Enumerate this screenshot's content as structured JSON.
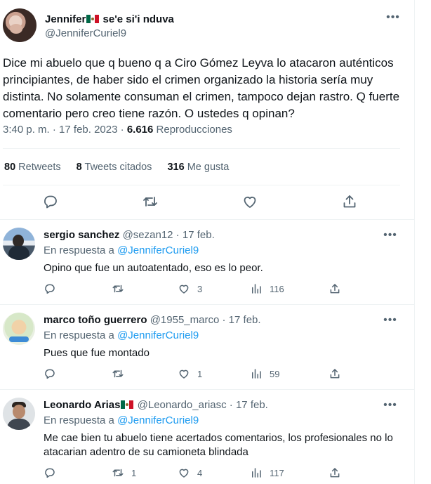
{
  "tweet": {
    "author_name": "Jennifer",
    "author_name_suffix": "se'e si'i nduva",
    "author_handle": "@JenniferCuriel9",
    "text": "Dice mi abuelo que q bueno q a Ciro Gómez Leyva lo atacaron auténticos principiantes, de haber sido el crimen organizado la historia sería muy distinta. No solamente consuman el crimen, tampoco dejan rastro. Q fuerte comentario pero creo tiene razón. O ustedes q opinan?",
    "time": "3:40 p. m.",
    "date": "17 feb. 2023",
    "views": "6.616",
    "views_label": "Reproducciones",
    "retweets": "80",
    "retweets_label": "Retweets",
    "quotes": "8",
    "quotes_label": "Tweets citados",
    "likes": "316",
    "likes_label": "Me gusta"
  },
  "reply_prefix": "En respuesta a",
  "replies": [
    {
      "name": "sergio sanchez",
      "handle": "@sezan12",
      "date": "17 feb.",
      "reply_to": "@JenniferCuriel9",
      "text": "Opino que fue un autoatentado, eso es lo peor.",
      "replies": "",
      "retweets": "",
      "likes": "3",
      "views": "116"
    },
    {
      "name": "marco toño guerrero",
      "handle": "@1955_marco",
      "date": "17 feb.",
      "reply_to": "@JenniferCuriel9",
      "text": "Pues que fue montado",
      "replies": "",
      "retweets": "",
      "likes": "1",
      "views": "59"
    },
    {
      "name": "Leonardo Arias",
      "handle": "@Leonardo_ariasc",
      "date": "17 feb.",
      "reply_to": "@JenniferCuriel9",
      "text": "Me cae bien tu abuelo tiene acertados comentarios, los profesionales no lo atacarian adentro de su camioneta blindada",
      "replies": "",
      "retweets": "1",
      "likes": "4",
      "views": "117"
    }
  ],
  "icons": {
    "reply": "reply-icon",
    "retweet": "retweet-icon",
    "like": "heart-icon",
    "views": "views-icon",
    "share": "share-icon",
    "more": "more-icon",
    "flag": "mexico-flag-icon"
  },
  "colors": {
    "text": "#0f1419",
    "muted": "#536471",
    "link": "#1d9bf0",
    "border": "#eff3f4"
  }
}
